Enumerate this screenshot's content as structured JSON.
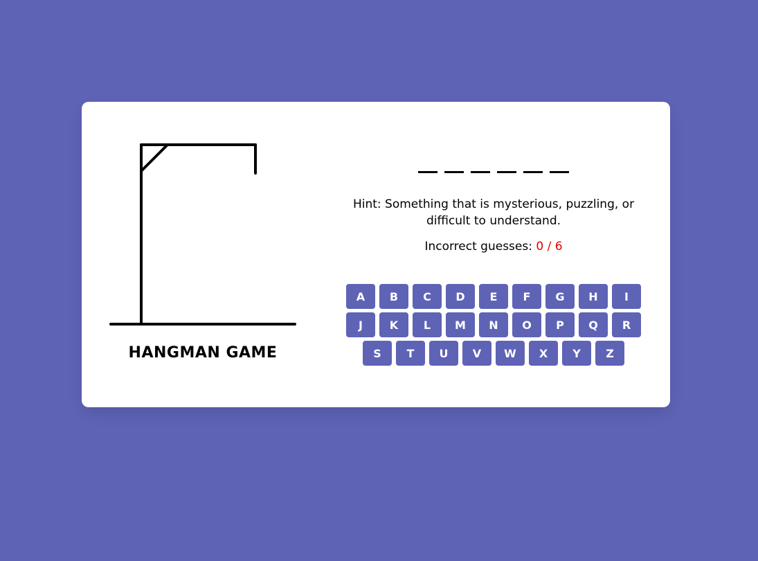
{
  "colors": {
    "background": "#5e63b6",
    "card": "#ffffff",
    "key_bg": "#5e63b6",
    "key_text": "#ffffff",
    "incorrect_count": "#e00000"
  },
  "game": {
    "title": "HANGMAN GAME",
    "word_slots": [
      "",
      "",
      "",
      "",
      "",
      ""
    ],
    "hint_label": "Hint:",
    "hint_text": "Something that is mysterious, puzzling, or difficult to understand.",
    "guesses_label": "Incorrect guesses:",
    "guesses_count": "0 / 6",
    "incorrect_guesses": 0,
    "max_guesses": 6
  },
  "keyboard": {
    "rows": [
      [
        "A",
        "B",
        "C",
        "D",
        "E",
        "F",
        "G",
        "H",
        "I"
      ],
      [
        "J",
        "K",
        "L",
        "M",
        "N",
        "O",
        "P",
        "Q",
        "R"
      ],
      [
        "S",
        "T",
        "U",
        "V",
        "W",
        "X",
        "Y",
        "Z"
      ]
    ]
  },
  "drawing": {
    "icon": "gallows-icon"
  }
}
